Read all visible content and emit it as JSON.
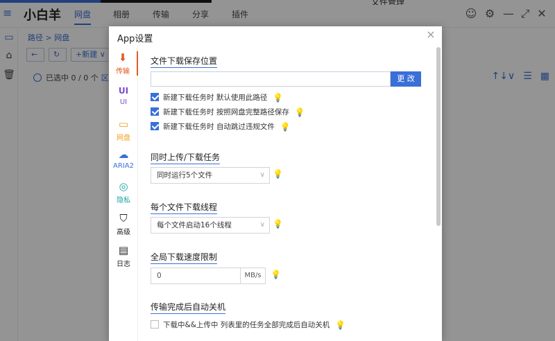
{
  "app": {
    "name": "小白羊",
    "tabs": [
      {
        "label": "网盘"
      },
      {
        "label": "相册"
      },
      {
        "label": "传输"
      },
      {
        "label": "分享"
      },
      {
        "label": "插件"
      }
    ],
    "top_right_icons": [
      "user-icon",
      "gear-icon",
      "minimize-icon",
      "fullscreen-icon",
      "close-icon"
    ],
    "peek_text": "文件管理"
  },
  "leftbar": {
    "icons": [
      "folder-icon",
      "album-icon",
      "trash-icon"
    ]
  },
  "breadcrumb": "路径 > 网盘",
  "toolbar": {
    "back": "←",
    "refresh": "↻",
    "new": "+新建 ∨"
  },
  "selection": {
    "text": "已选中 0 / 0 个",
    "filter": "区"
  },
  "right_tools": [
    "↑↓∨",
    "☰",
    "▦"
  ],
  "dialog": {
    "title": "App设置",
    "close": "×",
    "nav": [
      {
        "label": "传输",
        "icon": "⬇"
      },
      {
        "label": "UI",
        "icon": "UI"
      },
      {
        "label": "网盘",
        "icon": "▭"
      },
      {
        "label": "ARIA2",
        "icon": "☁"
      },
      {
        "label": "隐私",
        "icon": "◎"
      },
      {
        "label": "高级",
        "icon": "⛉"
      },
      {
        "label": "日志",
        "icon": "▤"
      }
    ],
    "sections": {
      "save_path_title": "文件下载保存位置",
      "save_path_value": "",
      "change_button": "更 改",
      "checkbox_1": "新建下载任务时 默认使用此路径",
      "checkbox_2": "新建下载任务时 按照网盘完整路径保存",
      "checkbox_3": "新建下载任务时 自动跳过违规文件",
      "concurrent_title": "同时上传/下载任务",
      "concurrent_value": "同时运行5个文件",
      "threads_title": "每个文件下载线程",
      "threads_value": "每个文件启动16个线程",
      "speed_title": "全局下载速度限制",
      "speed_value": "0",
      "speed_unit": "MB/s",
      "shutdown_title": "传输完成后自动关机",
      "checkbox_shutdown": "下载中&&上传中 列表里的任务全部完成后自动关机"
    }
  }
}
